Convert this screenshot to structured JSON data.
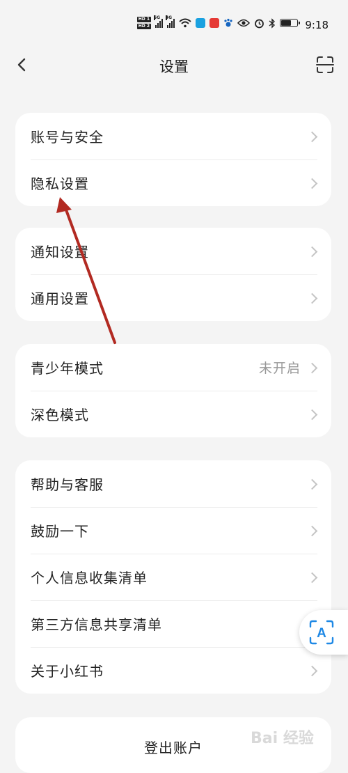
{
  "status_bar": {
    "time": "9:18",
    "hd1": "HD 1",
    "hd2": "HD 2",
    "net1": "5G",
    "net2": "4G",
    "icons": [
      "hd-icon",
      "signal-5g-icon",
      "signal-4g-icon",
      "wifi-icon",
      "app-blue-icon",
      "app-red-icon",
      "paw-icon",
      "eye-icon",
      "alarm-icon",
      "bluetooth-icon",
      "battery-icon"
    ]
  },
  "nav": {
    "title": "设置",
    "back_icon": "chevron-left-icon",
    "scan_icon": "scan-icon"
  },
  "groups": [
    {
      "items": [
        {
          "label": "账号与安全"
        },
        {
          "label": "隐私设置"
        }
      ]
    },
    {
      "items": [
        {
          "label": "通知设置"
        },
        {
          "label": "通用设置"
        }
      ]
    },
    {
      "items": [
        {
          "label": "青少年模式",
          "value": "未开启"
        },
        {
          "label": "深色模式"
        }
      ]
    },
    {
      "items": [
        {
          "label": "帮助与客服"
        },
        {
          "label": "鼓励一下"
        },
        {
          "label": "个人信息收集清单"
        },
        {
          "label": "第三方信息共享清单"
        },
        {
          "label": "关于小红书"
        }
      ]
    }
  ],
  "logout": {
    "label": "登出账户"
  },
  "floating": {
    "icon": "translate-icon",
    "glyph": "A"
  },
  "annotation": {
    "color": "#b22a22"
  },
  "watermark": "Bai 经验",
  "colors": {
    "background": "#f4f4f4",
    "card": "#ffffff",
    "muted_text": "#999999",
    "accent_blue": "#1e88e5"
  }
}
